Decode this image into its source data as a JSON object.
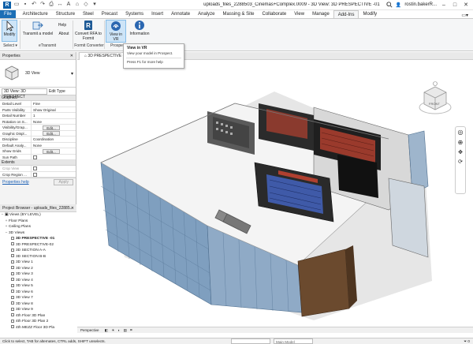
{
  "app": {
    "title": "uploads_files_2288503_Cinemas+Complex.0009 - 3D View: 3D PRESPECTIVE -01",
    "user": "rostin.bakerR...",
    "colors": {
      "accent": "#1c6fb6",
      "ribbon_bg": "#f5f6f7"
    }
  },
  "ribbon": {
    "tabs": [
      "File",
      "Architecture",
      "Structure",
      "Steel",
      "Precast",
      "Systems",
      "Insert",
      "Annotate",
      "Analyze",
      "Massing & Site",
      "Collaborate",
      "View",
      "Manage",
      "Add-Ins",
      "Modify"
    ],
    "active_tab": "Add-Ins",
    "buttons": {
      "modify": "Modify",
      "transmit": "Transmit a model",
      "help": "Help",
      "about": "About",
      "convert": "Convert RFA to Formit",
      "view_in_vr": "View in VR",
      "information": "Information"
    },
    "panels": {
      "select": "Select ▾",
      "etransmit": "eTransmit",
      "formit": "Formit Converter",
      "prospect": "Prospe"
    }
  },
  "tooltip": {
    "title": "View in VR",
    "description": "View your model in Prospect.",
    "help": "Press F1 for more help"
  },
  "properties": {
    "header": "Properties",
    "type_name": "3D View",
    "instance_selector": "3D View: 3D PRESPECT",
    "edit_type": "Edit Type",
    "categories": {
      "graphics": "Graphics",
      "extents": "Extents"
    },
    "graphics_rows": [
      {
        "key": "Detail Level",
        "value": "Fine"
      },
      {
        "key": "Parts Visibility",
        "value": "Show Original"
      },
      {
        "key": "Detail Number",
        "value": "1"
      },
      {
        "key": "Rotation on S...",
        "value": "None"
      },
      {
        "key": "Visibility/Grap...",
        "value": "Edit..."
      },
      {
        "key": "Graphic Displ...",
        "value": "Edit..."
      },
      {
        "key": "Discipline",
        "value": "Coordination"
      },
      {
        "key": "Default Analy...",
        "value": "None"
      },
      {
        "key": "Show Grids",
        "value": "Edit..."
      },
      {
        "key": "Sun Path",
        "value": ""
      }
    ],
    "extents_rows": [
      {
        "key": "Crop View",
        "value": ""
      },
      {
        "key": "Crop Region ...",
        "value": ""
      }
    ],
    "help_link": "Properties help",
    "apply": "Apply"
  },
  "browser": {
    "header": "Project Browser - uploads_files_22885...",
    "root": "Views (BY LEVEL)",
    "groups": [
      "Floor Plans",
      "Ceiling Plans",
      "3D Views"
    ],
    "views": [
      "3D PRESPECTIVE -01",
      "3D PRESPECTIVE-02",
      "3D SECTION A-A",
      "3D SECTION B-B",
      "3D View 1",
      "3D View 2",
      "3D View 3",
      "3D View 4",
      "3D View 5",
      "3D View 6",
      "3D View 7",
      "3D View 8",
      "3D View 9",
      "4th Floor 3D Plan",
      "4th Floor 3D Plan 2",
      "4th MEZZ Floor 3D Pla"
    ]
  },
  "view": {
    "tab": "3D PRESPECTIVE -01",
    "viewcube_face": "FRONT",
    "control_bar": "Perspective"
  },
  "status": {
    "text": "Click to select, TAB for alternates, CTRL adds, SHIFT unselects.",
    "workset": "",
    "model": "Main Model"
  }
}
